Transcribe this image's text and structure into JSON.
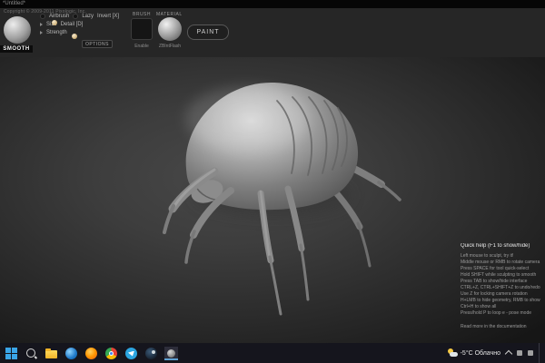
{
  "window": {
    "title": "*Untitled*",
    "copyright": "Copyright © 2009-2011 Pixologic, Inc."
  },
  "toolbar": {
    "brush_name": "SMOOTH",
    "airbrush_label": "Airbrush",
    "lazy_label": "Lazy",
    "invert_label": "Invert [X]",
    "size_label": "Size",
    "detail_label": "Detail [D]",
    "strength_label": "Strength",
    "options_label": "OPTIONS",
    "brush_section_label": "BRUSH",
    "enable_label": "Enable",
    "material_section_label": "MATERIAL",
    "material_name": "ZBIntFlash",
    "paint_label": "PAINT"
  },
  "help": {
    "title": "Quick help (F1 to show/hide)",
    "lines": [
      "Left mouse to sculpt, try it!",
      "Middle mouse or RMB to rotate camera",
      "Press SPACE for tool quick-select",
      "Hold SHIFT while sculpting to smooth",
      "Press TAB to show/hide interface",
      "CTRL+Z, CTRL+SHIFT+Z to undo/redo",
      "Use Z for locking camera rotation",
      "H+LMB to hide geometry, RMB to show",
      "Ctrl+H to show all",
      "Press/hold P to loop e - pose mode"
    ],
    "footer": "Read more in the documentation"
  },
  "taskbar": {
    "weather_label": "-5°C Облачно",
    "icons": [
      {
        "name": "start"
      },
      {
        "name": "search"
      },
      {
        "name": "file-explorer"
      },
      {
        "name": "edge"
      },
      {
        "name": "firefox"
      },
      {
        "name": "chrome"
      },
      {
        "name": "telegram"
      },
      {
        "name": "steam"
      },
      {
        "name": "sculptris",
        "active": true
      }
    ]
  },
  "colors": {
    "toolbar_bg": "#262626",
    "taskbar_bg": "#15151d",
    "viewport_center": "#484848",
    "taskbar_active_underline": "#5f9fd0"
  }
}
